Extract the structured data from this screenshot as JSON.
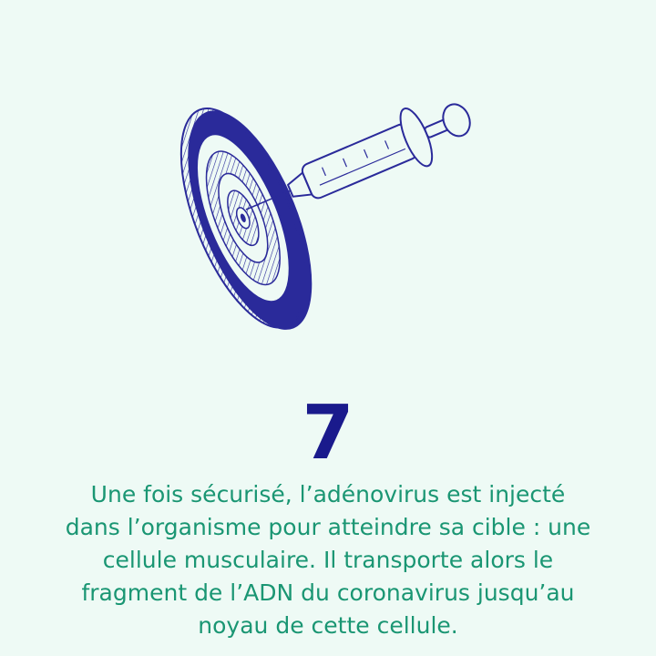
{
  "step": {
    "number": "7"
  },
  "caption": {
    "line1": "Une fois sécurisé, l’adénovirus est injecté",
    "line2": "dans l’organisme pour atteindre sa cible : une",
    "line3": "cellule musculaire. Il transporte alors le",
    "line4": "fragment de l’ADN du coronavirus jusqu’au",
    "line5": "noyau de cette cellule."
  },
  "colors": {
    "background": "#eefaf5",
    "number": "#1a1a8c",
    "text": "#1a9673",
    "ink": "#2a2a9a"
  },
  "illustration": {
    "icon": "syringe-injecting-target-icon"
  }
}
